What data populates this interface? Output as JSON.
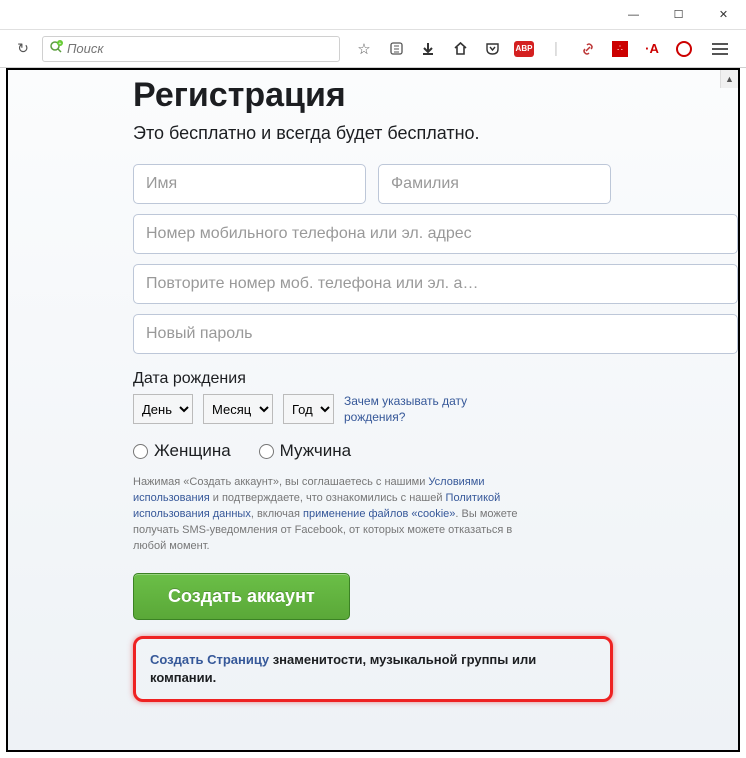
{
  "window": {
    "minimize_glyph": "—",
    "maximize_glyph": "☐",
    "close_glyph": "✕"
  },
  "toolbar": {
    "reload_glyph": "↻",
    "search_placeholder": "Поиск",
    "star_glyph": "☆",
    "clipboard_glyph": "📋",
    "download_glyph": "⬇",
    "home_glyph": "⌂",
    "pocket_glyph": "⌄",
    "abp_label": "ABP",
    "link_glyph": "🔗",
    "adv_label": "∴",
    "ra_label": "·A",
    "scroll_up_glyph": "▲"
  },
  "reg": {
    "title": "Регистрация",
    "subtitle": "Это бесплатно и всегда будет бесплатно.",
    "first_name_ph": "Имя",
    "last_name_ph": "Фамилия",
    "mobile_ph": "Номер мобильного телефона или эл. адрес",
    "mobile_repeat_ph": "Повторите номер моб. телефона или эл. а…",
    "password_ph": "Новый пароль",
    "dob_label": "Дата рождения",
    "day_opt": "День",
    "month_opt": "Месяц",
    "year_opt": "Год",
    "dob_help": "Зачем указывать дату рождения?",
    "gender_f": "Женщина",
    "gender_m": "Мужчина",
    "terms_pre": "Нажимая «Создать аккаунт», вы соглашаетесь с нашими ",
    "terms_link1": "Условиями использования",
    "terms_mid1": " и подтверждаете, что ознакомились с нашей ",
    "terms_link2": "Политикой использования данных",
    "terms_mid2": ", включая ",
    "terms_link3": "применение файлов «cookie»",
    "terms_post": ". Вы можете получать SMS-уведомления от Facebook, от которых можете отказаться в любой момент.",
    "create_btn": "Создать аккаунт",
    "page_link_action": "Создать Страницу",
    "page_link_rest": " знаменитости, музыкальной группы или компании."
  }
}
